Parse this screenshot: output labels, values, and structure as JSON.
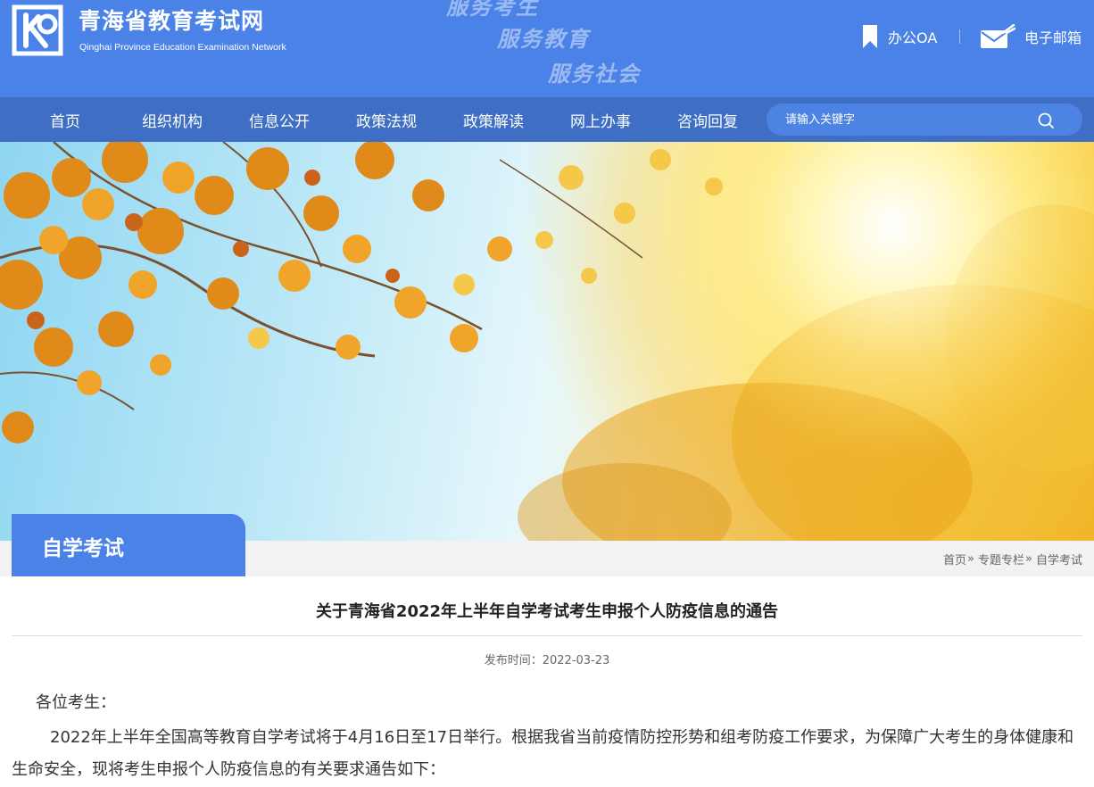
{
  "header": {
    "site_title": "青海省教育考试网",
    "site_subtitle": "Qinghai Province Education Examination Network",
    "slogans": [
      "服务考生",
      "服务教育",
      "服务社会"
    ],
    "office_oa_label": "办公OA",
    "email_label": "电子邮箱",
    "colors": {
      "header_bg": "#4a82e8",
      "nav_bg": "#3f6fc4"
    }
  },
  "nav": {
    "items": [
      "首页",
      "组织机构",
      "信息公开",
      "政策法规",
      "政策解读",
      "网上办事",
      "咨询回复"
    ],
    "search_placeholder": "请输入关键字"
  },
  "section": {
    "title": "自学考试",
    "breadcrumb": [
      "首页",
      "专题专栏",
      "自学考试"
    ],
    "breadcrumb_separator": "»"
  },
  "article": {
    "title": "关于青海省2022年上半年自学考试考生申报个人防疫信息的通告",
    "publish_label": "发布时间：2022-03-23",
    "greeting": "各位考生：",
    "paragraph_1": "2022年上半年全国高等教育自学考试将于4月16日至17日举行。根据我省当前疫情防控形势和组考防疫工作要求，为保障广大考生的身体健康和生命安全，现将考生申报个人防疫信息的有关要求通告如下："
  },
  "icons": {
    "logo": "qhee-logo-icon",
    "office_oa": "bookmark-icon",
    "email": "envelope-icon",
    "search": "search-icon"
  }
}
